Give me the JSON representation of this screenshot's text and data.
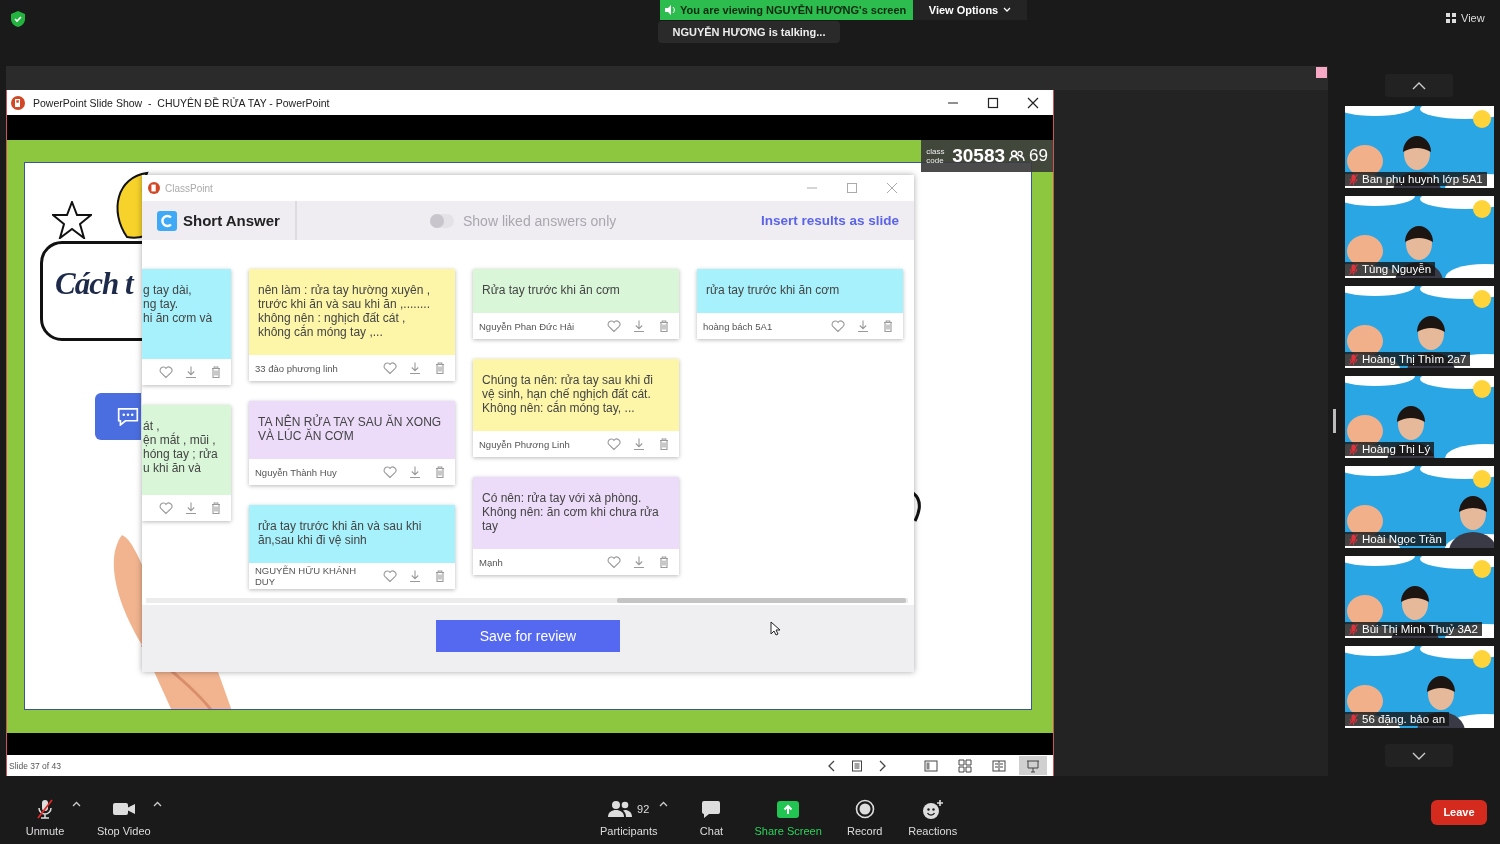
{
  "top_bar": {
    "banner": "You are viewing NGUYỄN HƯƠNG's screen",
    "view_options": "View Options",
    "talking_notice": "NGUYỄN HƯƠNG is talking...",
    "view_button": "View"
  },
  "powerpoint": {
    "title": "PowerPoint Slide Show  -  CHUYÊN ĐỀ RỬA TAY - PowerPoint",
    "slide_counter": "Slide 37 of 43",
    "view_buttons": [
      {
        "kind": "normal",
        "selected": false
      },
      {
        "kind": "sorter",
        "selected": false
      },
      {
        "kind": "reading",
        "selected": false
      },
      {
        "kind": "slideshow",
        "selected": true
      }
    ]
  },
  "slide": {
    "heading": "Cách t",
    "class_code_label": "class code",
    "class_code": "30583",
    "student_count": "69"
  },
  "classpoint": {
    "title": "ClassPoint",
    "activity": "Short Answer",
    "liked_filter": {
      "label": "Show liked answers only",
      "on": false
    },
    "insert_link": "Insert results as slide",
    "save_button": "Save for review",
    "columns": [
      {
        "kind": "cut",
        "cards": [
          {
            "text": "g tay dài,\nng tay.\nhi ăn cơm và",
            "color": "#a6f1fb"
          },
          {
            "text": "át ,\nện mắt , mũi ,\nhóng tay ; rửa\nu khi ăn và",
            "color": "#d9f6d9"
          }
        ]
      },
      {
        "kind": "full",
        "cards": [
          {
            "text": "nên làm : rửa tay hường xuyên ,\ntrước khi ăn và sau khi ăn ,........\nkhông nên : nghịch đất cát ,\nkhông cắn móng tay ,...",
            "author": "33 đào phương linh",
            "color": "#fdf6a9"
          },
          {
            "text": "TA NÊN RỬA TAY SAU ĂN XONG\nVÀ LÚC ĂN CƠM",
            "author": "Nguyễn Thành Huy",
            "color": "#ecdcfa"
          },
          {
            "text": "rửa tay trước khi ăn và sau khi\năn,sau khi đi vệ sinh",
            "author": "NGUYỄN HỮU KHÁNH DUY",
            "color": "#a6f1fb"
          }
        ]
      },
      {
        "kind": "full",
        "cards": [
          {
            "text": "Rửa tay trước khi ăn cơm",
            "author": "Nguyễn Phan Đức Hải",
            "color": "#d9f6d9"
          },
          {
            "text": "Chúng ta nên: rửa tay sau khi đi\nvệ sinh, hạn chế nghịch đất cát.\nKhông nên: cắn móng tay, ...",
            "author": "Nguyễn Phương Linh",
            "color": "#fdf6a9"
          },
          {
            "text": "Có nên: rửa tay với xà phòng.\nKhông nên: ăn cơm khi chưa rửa\ntay",
            "author": "Mạnh",
            "color": "#ecdcfa"
          }
        ]
      },
      {
        "kind": "full",
        "cards": [
          {
            "text": "rửa tay trước khi ăn cơm",
            "author": "hoàng bách 5A1",
            "color": "#a6f1fb"
          }
        ]
      }
    ]
  },
  "participants": [
    {
      "name": "Ban phụ huynh lớp 5A1",
      "muted": true
    },
    {
      "name": "Tùng Nguyễn",
      "muted": true
    },
    {
      "name": "Hoàng Thị Thìm 2a7",
      "muted": true
    },
    {
      "name": "Hoàng Thị Lý",
      "muted": true
    },
    {
      "name": "Hoài Ngọc Trần",
      "muted": true
    },
    {
      "name": "Bùi Thị Minh Thuỷ 3A2",
      "muted": true
    },
    {
      "name": "56 đặng. bảo an",
      "muted": true
    }
  ],
  "toolbar": [
    {
      "kind": "mic",
      "label": "Unmute",
      "muted": true,
      "caret": true
    },
    {
      "kind": "video",
      "label": "Stop Video",
      "caret": true
    },
    {
      "kind": "participants",
      "label": "Participants",
      "count": "92",
      "caret": true
    },
    {
      "kind": "chat",
      "label": "Chat",
      "caret": false
    },
    {
      "kind": "share",
      "label": "Share Screen",
      "caret": false
    },
    {
      "kind": "record",
      "label": "Record",
      "caret": false
    },
    {
      "kind": "reactions",
      "label": "Reactions",
      "caret": false
    }
  ],
  "leave_button": "Leave"
}
